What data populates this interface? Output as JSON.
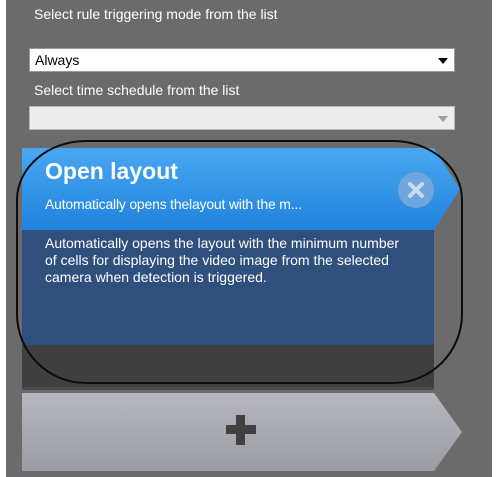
{
  "trigger": {
    "label": "Select rule triggering mode from the list",
    "value": "Always"
  },
  "schedule": {
    "label": "Select time schedule from the list",
    "value": ""
  },
  "card": {
    "title": "Open layout",
    "subtitle": "Automatically opens thelayout with the m...",
    "description": "Automatically opens the layout with the minimum number of cells for displaying the video image from the selected camera when detection is triggered."
  },
  "icons": {
    "close": "close-icon",
    "add": "plus-icon",
    "dropdown": "chevron-down-icon"
  },
  "colors": {
    "panel": "#6b6b6b",
    "card_header": "#2f8fe6",
    "card_body": "#2f4f7c",
    "add_card": "#a9a9b2"
  }
}
